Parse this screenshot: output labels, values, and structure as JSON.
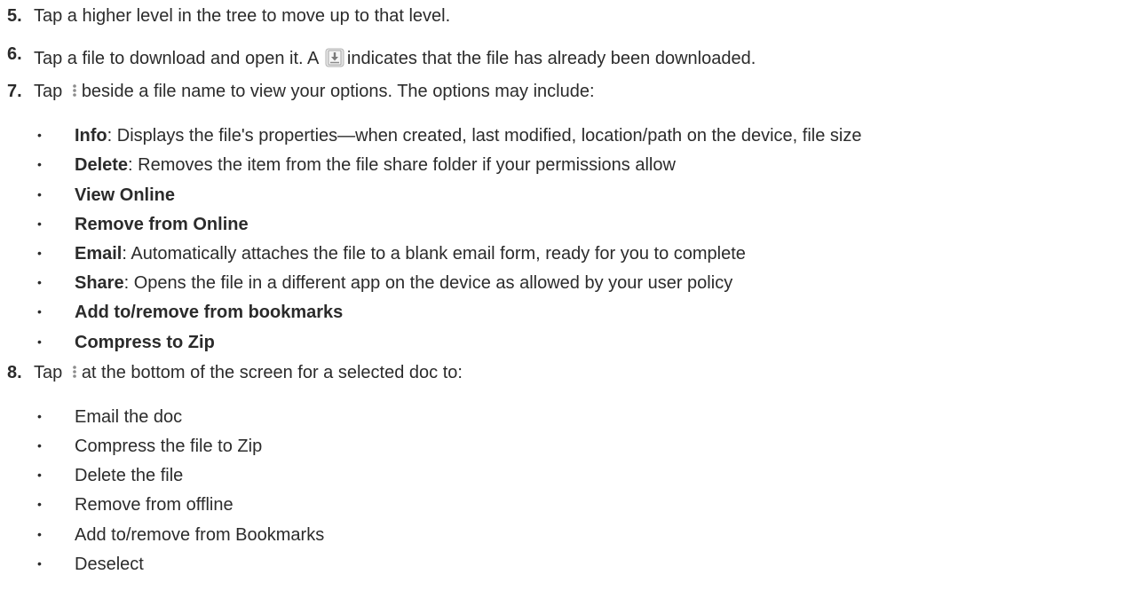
{
  "steps": [
    {
      "number": "5.",
      "text": "Tap a higher level in the tree to move up to that level."
    },
    {
      "number": "6.",
      "pre": "Tap a file to download and open it. A",
      "icon": "download-badge-icon",
      "post": "indicates that the file has already been downloaded."
    },
    {
      "number": "7.",
      "pre": "Tap",
      "icon": "kebab-menu-icon",
      "post": "beside a file name to view your options. The options may include:"
    },
    {
      "number": "8.",
      "pre": "Tap",
      "icon": "kebab-menu-icon",
      "post": "at the bottom of the screen for a selected doc to:"
    }
  ],
  "options": [
    {
      "bold": "Info",
      "rest": ": Displays the file's properties—when created, last modified, location/path on the device, file size"
    },
    {
      "bold": "Delete",
      "rest": ": Removes the item from the file share folder if your permissions allow"
    },
    {
      "bold": "View Online",
      "rest": ""
    },
    {
      "bold": "Remove from Online",
      "rest": ""
    },
    {
      "bold": "Email",
      "rest": ": Automatically attaches the file to a blank email form, ready for you to complete"
    },
    {
      "bold": "Share",
      "rest": ": Opens the file in a different app on the device as allowed by your user policy"
    },
    {
      "bold": "Add to/remove from bookmarks",
      "rest": ""
    },
    {
      "bold": "Compress to Zip",
      "rest": ""
    }
  ],
  "actions": [
    "Email the doc",
    "Compress the file to Zip",
    "Delete the file",
    "Remove from offline",
    "Add to/remove from Bookmarks",
    "Deselect"
  ],
  "colors": {
    "text": "#2b2b2b",
    "icon_grey": "#9a9a9a",
    "icon_bg": "#e6e6e6"
  }
}
